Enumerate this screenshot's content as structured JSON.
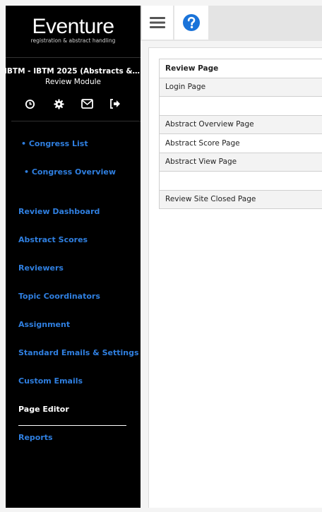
{
  "brand": {
    "name": "Eventure",
    "tagline": "registration & abstract handling"
  },
  "sidebar": {
    "congress_name": "IBTM - IBTM 2025 (Abstracts & Par...",
    "module_name": "Review Module",
    "icons": [
      "clock-icon",
      "gear-icon",
      "envelope-icon",
      "sign-out-icon"
    ],
    "sub_items": [
      {
        "label": "• Congress List"
      },
      {
        "label": "• Congress Overview"
      }
    ],
    "items": [
      {
        "label": "Review Dashboard"
      },
      {
        "label": "Abstract Scores"
      },
      {
        "label": "Reviewers"
      },
      {
        "label": "Topic Coordinators"
      },
      {
        "label": "Assignment"
      },
      {
        "label": "Standard Emails & Settings"
      },
      {
        "label": "Custom Emails"
      },
      {
        "label": "Page Editor",
        "active": true
      },
      {
        "label": "Reports"
      }
    ]
  },
  "topbar": {
    "menu_icon": "hamburger-icon",
    "help_icon": "help-icon",
    "accent_color": "#1a73d9"
  },
  "pages_table": {
    "rows": [
      {
        "label": "Review Page"
      },
      {
        "label": "Login Page"
      },
      {
        "label": ""
      },
      {
        "label": "Abstract Overview Page"
      },
      {
        "label": "Abstract Score Page"
      },
      {
        "label": "Abstract View Page"
      },
      {
        "label": ""
      },
      {
        "label": "Review Site Closed Page"
      }
    ]
  },
  "colors": {
    "sidebar_bg": "#000000",
    "link": "#2f7fe0",
    "active_link": "#ffffff"
  }
}
